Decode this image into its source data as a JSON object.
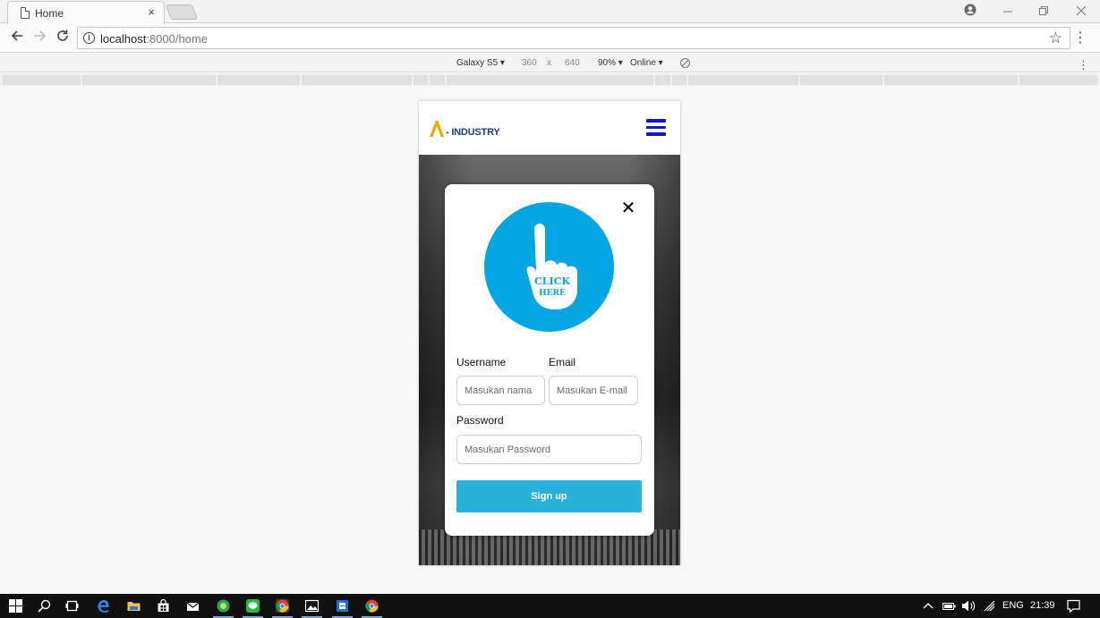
{
  "browser": {
    "tab_title": "Home",
    "tab_close": "×",
    "url_host": "localhost",
    "url_path": ":8000/home",
    "info_glyph": "i"
  },
  "device_toolbar": {
    "device": "Galaxy S5 ▾",
    "width": "360",
    "times": "x",
    "height": "640",
    "zoom": "90% ▾",
    "network": "Online ▾"
  },
  "site": {
    "logo_text": "- INDUSTRY",
    "logo_color": "#f5a800",
    "menu_color": "#1413c6"
  },
  "modal": {
    "close_glyph": "✕",
    "graphic_text_1": "CLICK",
    "graphic_text_2": "HERE",
    "username_label": "Username",
    "username_placeholder": "Masukan nama",
    "email_label": "Email",
    "email_placeholder": "Masukan E-mail",
    "password_label": "Password",
    "password_placeholder": "Masukan Password",
    "signup_label": "Sign up",
    "accent_color": "#29b1dc"
  },
  "taskbar": {
    "language": "ENG",
    "time": "21:39"
  }
}
